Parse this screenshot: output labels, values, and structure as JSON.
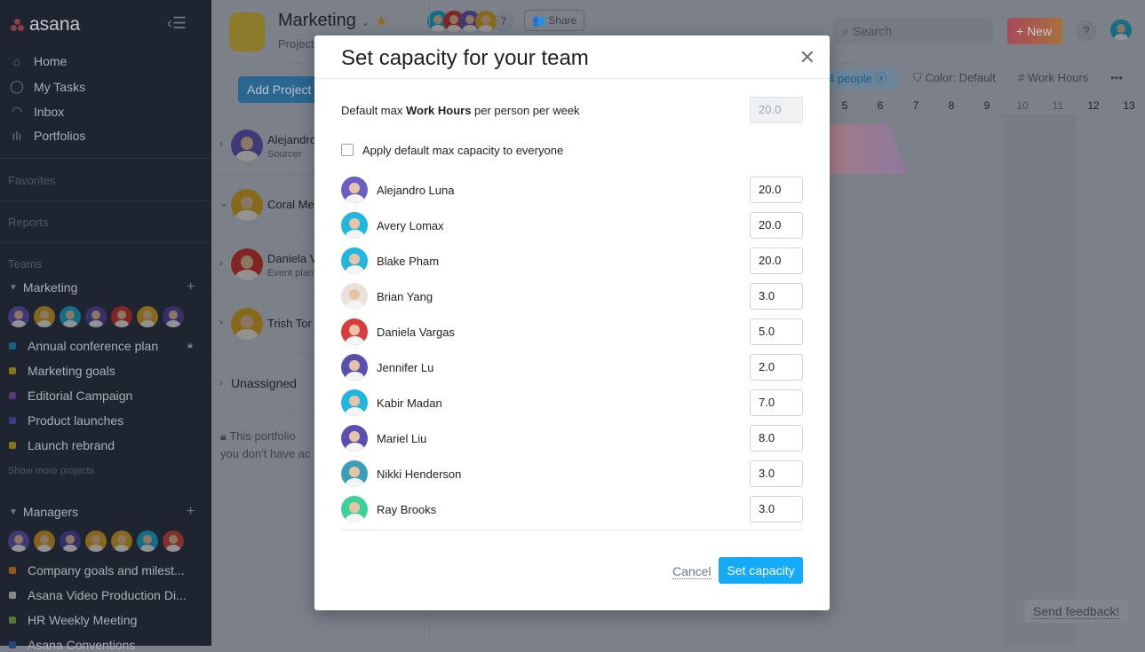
{
  "sidebar": {
    "logo": "asana",
    "nav": [
      {
        "label": "Home",
        "icon": "home-icon"
      },
      {
        "label": "My Tasks",
        "icon": "check-circle-icon"
      },
      {
        "label": "Inbox",
        "icon": "bell-icon"
      },
      {
        "label": "Portfolios",
        "icon": "bar-chart-icon"
      }
    ],
    "favorites": "Favorites",
    "reports": "Reports",
    "teams": "Teams",
    "marketing": {
      "name": "Marketing",
      "avatars": [
        "#6b5fc7",
        "#d9a62e",
        "#1fb6e0",
        "#5a4fb0",
        "#d93c3c",
        "#e0b02a",
        "#5a4fb0"
      ],
      "projects": [
        {
          "name": "Annual conference plan",
          "color": "#1ea7d9",
          "locked": true
        },
        {
          "name": "Marketing goals",
          "color": "#e0c324"
        },
        {
          "name": "Editorial Campaign",
          "color": "#9b5dd8"
        },
        {
          "name": "Product launches",
          "color": "#6b5fe0"
        },
        {
          "name": "Launch rebrand",
          "color": "#e0c324"
        }
      ],
      "show_more": "Show more projects"
    },
    "managers": {
      "name": "Managers",
      "avatars": [
        "#6b5fc7",
        "#d9a62e",
        "#5a4fb0",
        "#e0b02a",
        "#e0b02a",
        "#1fb6e0",
        "#d94f4f"
      ],
      "projects": [
        {
          "name": "Company goals and milest...",
          "color": "#f0952a"
        },
        {
          "name": "Asana Video Production Di...",
          "color": "#dfe2e6"
        },
        {
          "name": "HR Weekly Meeting",
          "color": "#8bc34a"
        },
        {
          "name": "Asana Conventions",
          "color": "#3a78d6"
        }
      ]
    }
  },
  "header": {
    "title": "Marketing",
    "subtitle": "Projects",
    "member_count": "7",
    "share": "Share",
    "add_project": "Add Project",
    "search_placeholder": "Search",
    "new": "+ New",
    "help": "?",
    "filter": "4 people",
    "color": "Color: Default",
    "field": "Work Hours",
    "more": "•••",
    "days": [
      "5",
      "6",
      "7",
      "8",
      "9",
      "10",
      "11",
      "12",
      "13"
    ]
  },
  "rows": [
    {
      "name": "Alejandro",
      "role": "Sourcer",
      "color": "#6b5fc7"
    },
    {
      "name": "Coral Me",
      "role": "",
      "color": "#e0b02a"
    },
    {
      "name": "Daniela V",
      "role": "Event plan",
      "color": "#d93c3c"
    },
    {
      "name": "Trish Tor",
      "role": "",
      "color": "#e0b02a"
    }
  ],
  "unassigned": "Unassigned",
  "notice1": "This portfolio",
  "notice2": "you don't have ac",
  "modal": {
    "title": "Set capacity for your team",
    "default_pre": "Default max ",
    "default_bold": "Work Hours",
    "default_post": " per person per week",
    "default_value": "20.0",
    "apply_label": "Apply default max capacity to everyone",
    "apply_checked": false,
    "people": [
      {
        "name": "Alejandro Luna",
        "value": "20.0",
        "color": "#6b5fc7"
      },
      {
        "name": "Avery Lomax",
        "value": "20.0",
        "color": "#1fb6e0"
      },
      {
        "name": "Blake Pham",
        "value": "20.0",
        "color": "#1fb6e0"
      },
      {
        "name": "Brian Yang",
        "value": "3.0",
        "color": "#e8e2da"
      },
      {
        "name": "Daniela Vargas",
        "value": "5.0",
        "color": "#d93c3c"
      },
      {
        "name": "Jennifer Lu",
        "value": "2.0",
        "color": "#5a4fb0"
      },
      {
        "name": "Kabir Madan",
        "value": "7.0",
        "color": "#1fb6e0"
      },
      {
        "name": "Mariel Liu",
        "value": "8.0",
        "color": "#5a4fb0"
      },
      {
        "name": "Nikki Henderson",
        "value": "3.0",
        "color": "#3aa0b8"
      },
      {
        "name": "Ray Brooks",
        "value": "3.0",
        "color": "#3ad49a"
      }
    ],
    "cancel": "Cancel",
    "submit": "Set capacity"
  },
  "feedback": "Send feedback!"
}
